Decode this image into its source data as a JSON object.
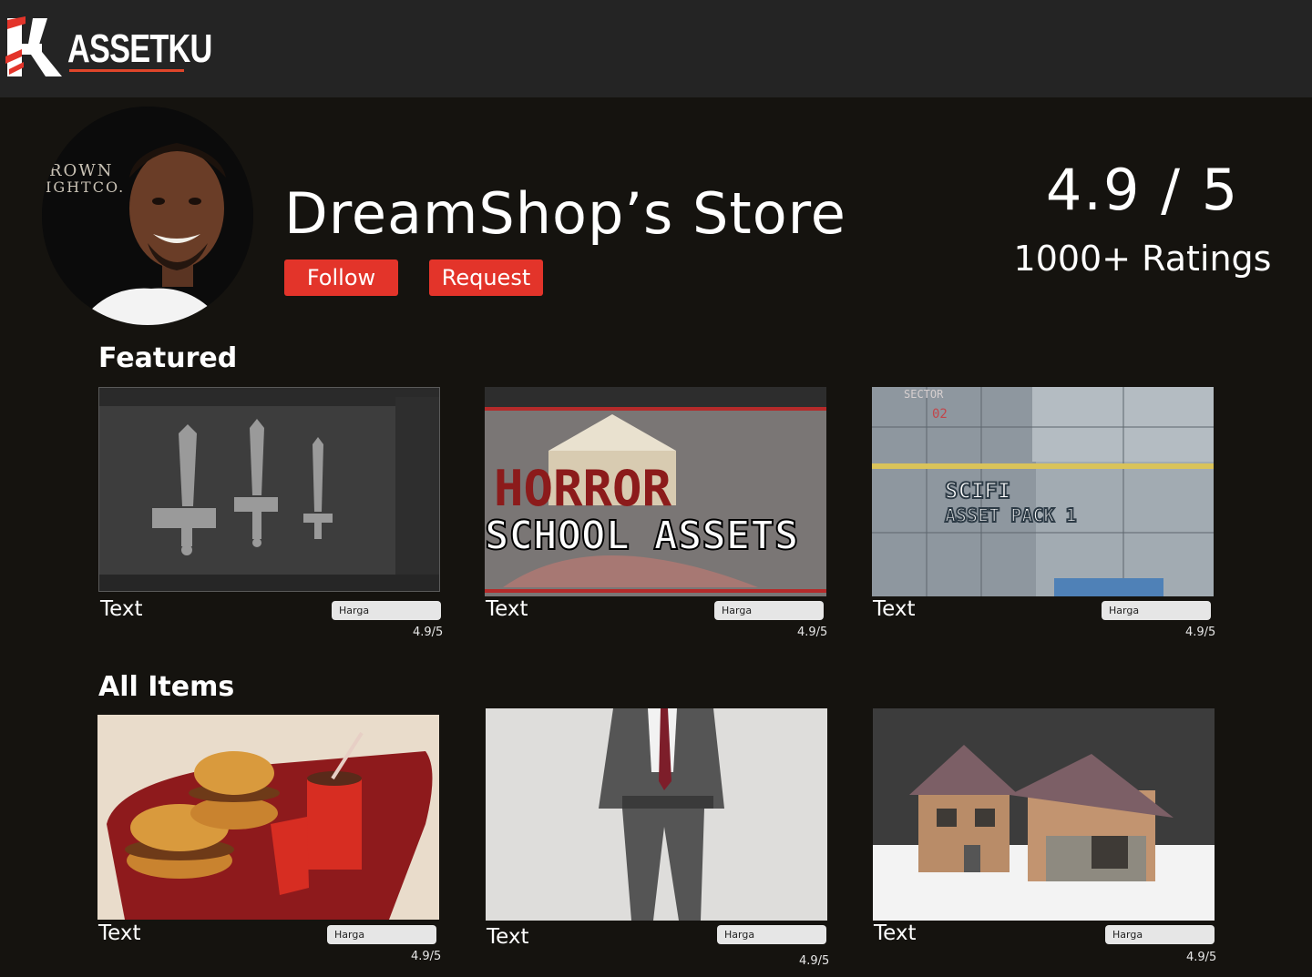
{
  "brand": {
    "name": "ASSETKU",
    "accent": "#e3342a"
  },
  "store": {
    "name": "DreamShop’s Store",
    "avatar_backdrop_text": [
      "ROWN",
      "IGHTCO."
    ],
    "follow_label": "Follow",
    "request_label": "Request",
    "rating": "4.9 / 5",
    "rating_count": "1000+ Ratings"
  },
  "featured": {
    "title": "Featured",
    "items": [
      {
        "title": "Text",
        "price_label": "Harga",
        "rating": "4.9/5",
        "thumbnail": "blender-swords-thumbnail"
      },
      {
        "title": "Text",
        "price_label": "Harga",
        "rating": "4.9/5",
        "thumbnail": "horror-school-assets-thumbnail",
        "banner_line1": "HORROR",
        "banner_line2": "SCHOOL ASSETS"
      },
      {
        "title": "Text",
        "price_label": "Harga",
        "rating": "4.9/5",
        "thumbnail": "scifi-asset-pack-thumbnail",
        "banner_line1": "SCIFI",
        "banner_line2": "ASSET PACK 1",
        "sign": "SECTOR",
        "sign_number": "02"
      }
    ]
  },
  "all_items": {
    "title": "All Items",
    "items": [
      {
        "title": "Text",
        "price_label": "Harga",
        "rating": "4.9/5",
        "thumbnail": "burger-meal-thumbnail"
      },
      {
        "title": "Text",
        "price_label": "Harga",
        "rating": "4.9/5",
        "thumbnail": "businessman-model-thumbnail"
      },
      {
        "title": "Text",
        "price_label": "Harga",
        "rating": "4.9/5",
        "thumbnail": "house-model-thumbnail"
      }
    ]
  }
}
